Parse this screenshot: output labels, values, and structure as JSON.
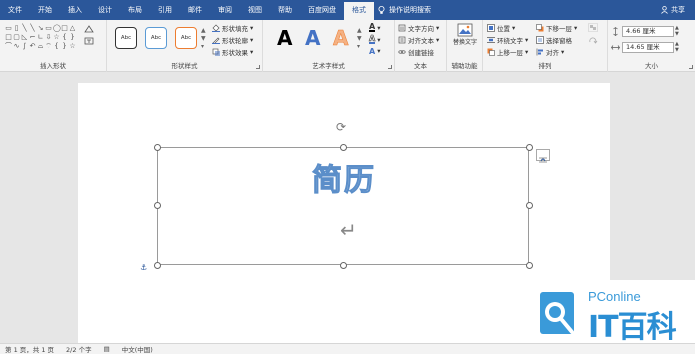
{
  "tabs": [
    "文件",
    "开始",
    "插入",
    "设计",
    "布局",
    "引用",
    "邮件",
    "审阅",
    "视图",
    "帮助",
    "百度网盘",
    "格式"
  ],
  "active_tab": "格式",
  "tell_me": "操作说明搜索",
  "share": "共享",
  "ribbon": {
    "insert_shapes_label": "插入形状",
    "shape_styles_label": "形状样式",
    "style_preset_text": "Abc",
    "shape_fill": "形状填充",
    "shape_outline": "形状轮廓",
    "shape_effects": "形状效果",
    "wordart_label": "艺术字样式",
    "text_direction": "文字方向",
    "align_text": "对齐文本",
    "create_link": "创建链接",
    "text_label": "文本",
    "alt_text": "替换文字",
    "accessibility_label": "辅助功能",
    "position": "位置",
    "wrap_text": "环绕文字",
    "bring_forward": "上移一层",
    "send_backward": "下移一层",
    "selection_pane": "选择窗格",
    "align": "对齐",
    "arrange_label": "排列",
    "height": "4.66 厘米",
    "width": "14.65 厘米",
    "size_label": "大小"
  },
  "document": {
    "title_text": "简历",
    "enter_symbol": "↵"
  },
  "watermark": {
    "brand": "PConline",
    "main": "IT百科"
  },
  "status": {
    "page": "第 1 页，共 1 页",
    "words": "2/2 个字",
    "lang": "中文(中国)"
  },
  "colors": {
    "ribbon_blue": "#2b579a",
    "wordart_fill": "#a8c6e6",
    "wordart_outline": "#5b8ec9"
  }
}
